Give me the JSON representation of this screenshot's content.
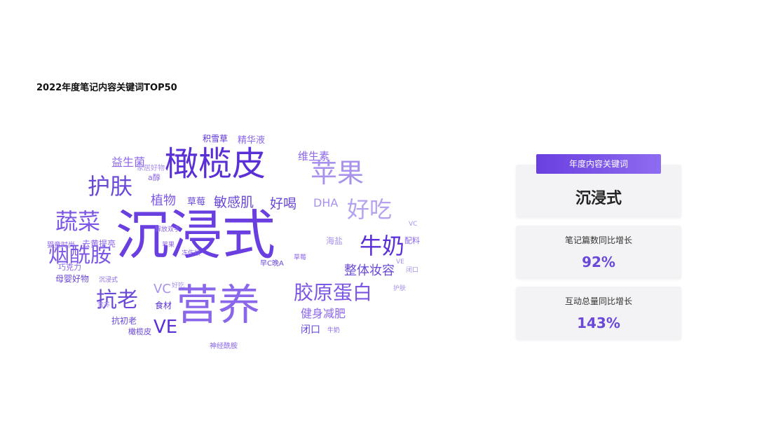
{
  "page": {
    "title": "2022年度笔记内容关键词TOP50"
  },
  "wordcloud": {
    "words": [
      "沉浸式",
      "营养",
      "橄榄皮",
      "苹果",
      "护肤",
      "蔬菜",
      "好吃",
      "烟酰胺",
      "牛奶",
      "抗老",
      "胶原蛋白",
      "VE",
      "敏感肌",
      "好喝",
      "植物",
      "益生菌",
      "维生素",
      "整体妆容",
      "健身减肥",
      "DHA",
      "草莓",
      "积雪草",
      "精华液",
      "VC",
      "母婴好物",
      "去黄提亮",
      "抗初老",
      "食材",
      "闭口",
      "海盐",
      "配料",
      "巧克力",
      "a醇",
      "家居好物",
      "婴童时尚",
      "橄榄皮",
      "神经酰胺",
      "早C晚A",
      "VC",
      "VE",
      "牛奶",
      "护肤",
      "闭口",
      "苹果",
      "草莓",
      "营养",
      "好吃",
      "沉浸式",
      "解放双手",
      "冻伤妆"
    ]
  },
  "summary": {
    "keyword_badge": "年度内容关键词",
    "keyword_value": "沉浸式",
    "notes_label": "笔记篇数同比增长",
    "notes_value": "92%",
    "interaction_label": "互动总量同比增长",
    "interaction_value": "143%"
  },
  "colors": {
    "accent": "#6a3fe0",
    "deep": "#5a2fd6",
    "light": "#a992ee"
  }
}
